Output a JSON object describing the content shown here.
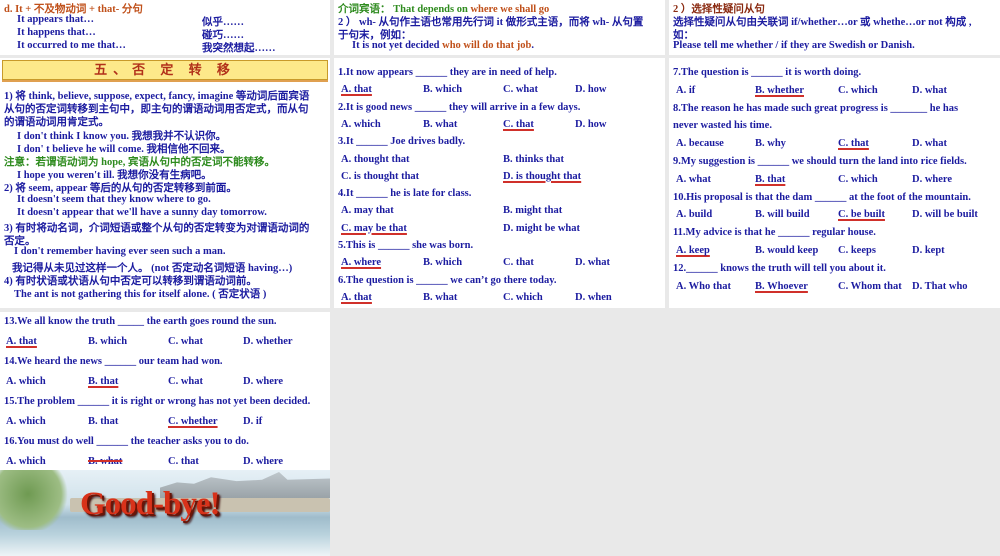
{
  "slide_tl": {
    "heading": "d. It + 不及物动词 + that- 分句",
    "rows": [
      {
        "en": "It appears that…",
        "zh": "似乎……"
      },
      {
        "en": "It happens that…",
        "zh": "碰巧……"
      },
      {
        "en": "It occurred to me that…",
        "zh": "我突然想起……"
      }
    ]
  },
  "slide_tm": {
    "clipped": "介词宾语： That depends on ",
    "clipped_hl": "where we shall go",
    "line1": "2 ） wh- 从句作主语也常用先行词 it 做形式主语，而将 wh- 从句置",
    "line2": "于句末，例如：",
    "ex_a": "It is not yet decided ",
    "ex_hl": "who will do that job",
    "ex_end": "."
  },
  "slide_tr": {
    "heading": "2 ）选择性疑问从句",
    "line1": "选择性疑问从句由关联词 if/whether…or 或 whethe…or not 构成 ,",
    "line2": "如：",
    "example": "Please tell me whether / if they are Swedish or Danish."
  },
  "slide_neg": {
    "title": "五、否 定 转 移",
    "lines": [
      {
        "t": "1)  将 think, believe, suppose, expect, fancy, imagine 等动词后面宾语",
        "c": "",
        "i": 0
      },
      {
        "t": "从句的否定词转移到主句中，即主句的谓语动词用否定式，而从句",
        "c": "",
        "i": 0
      },
      {
        "t": "的谓语动词用肯定式。",
        "c": "",
        "i": 0
      },
      {
        "t": "I don't think I know you.     我想我并不认识你。",
        "c": "",
        "i": 1
      },
      {
        "t": "I don' t believe he will come.     我相信他不回来。",
        "c": "",
        "i": 1
      },
      {
        "t": "注意：若谓语动词为 hope, 宾语从句中的否定词不能转移。",
        "c": "green",
        "i": 0
      },
      {
        "t": "I hope you weren't ill.  我想你没有生病吧。",
        "c": "",
        "i": 1
      },
      {
        "t": "2)  将 seem, appear  等后的从句的否定转移到前面。",
        "c": "",
        "i": 0
      },
      {
        "t": "It doesn't seem that they know where to go.",
        "c": "",
        "i": 1
      },
      {
        "t": "It doesn't appear that we'll have a sunny day tomorrow.",
        "c": "",
        "i": 1
      },
      {
        "t": "3)  有时将动名词，介词短语或整个从句的否定转变为对谓语动词的",
        "c": "",
        "i": 0
      },
      {
        "t": "否定。",
        "c": "",
        "i": 0
      },
      {
        "t": "I don't remember having ever seen such a man.",
        "c": "",
        "i": 2
      },
      {
        "t": "我记得从未见过这样一个人。   (not 否定动名词短语   having…)",
        "c": "",
        "i": 3
      },
      {
        "t": "4)  有时状语或状语从句中否定可以转移到谓语动词前。",
        "c": "",
        "i": 0
      },
      {
        "t": "The ant is not gathering this for itself alone.      ( 否定状语 )",
        "c": "",
        "i": 2
      }
    ]
  },
  "quiz_mid": [
    {
      "q": "1.It now appears ______ they are in need of help.",
      "cols": 4,
      "opts": [
        "A. that",
        "B. which",
        "C. what",
        "D. how"
      ],
      "ans": 0
    },
    {
      "q": "2.It is good news ______ they will arrive in a few days.",
      "cols": 4,
      "opts": [
        "A. which",
        "B. what",
        "C. that",
        "D. how"
      ],
      "ans": 2
    },
    {
      "q": "3.It ______ Joe drives badly.",
      "cols": 2,
      "opts": [
        "A. thought that",
        "B. thinks that",
        "C. is thought that",
        "D. is thought that"
      ],
      "ans": 3
    },
    {
      "q": "4.It ______ he is late for class.",
      "cols": 2,
      "opts": [
        "A. may that",
        "B. might that",
        "C. may be that",
        "D. might be what"
      ],
      "ans": 2
    },
    {
      "q": "5.This is ______ she was born.",
      "cols": 4,
      "opts": [
        "A. where",
        "B. which",
        "C. that",
        "D. what"
      ],
      "ans": 0
    },
    {
      "q": "6.The question is ______ we can’t go there today.",
      "cols": 4,
      "opts": [
        "A. that",
        "B. what",
        "C. which",
        "D. when"
      ],
      "ans": 0
    }
  ],
  "quiz_right": [
    {
      "q": "7.The question is ______ it is worth doing.",
      "cols": 4,
      "opts": [
        "A. if",
        "B. whether",
        "C. which",
        "D. what"
      ],
      "ans": 1
    },
    {
      "q": "8.The reason he has made such great progress is _______ he has",
      "q2": "never wasted his time.",
      "cols": 4,
      "opts": [
        "A. because",
        "B. why",
        "C. that",
        "D. what"
      ],
      "ans": 2
    },
    {
      "q": "9.My suggestion is ______ we should turn the land into rice fields.",
      "cols": 4,
      "opts": [
        "A. what",
        "B. that",
        "C. which",
        "D. where"
      ],
      "ans": 1
    },
    {
      "q": "10.His proposal is that the dam ______ at the foot of the mountain.",
      "cols": 4,
      "opts": [
        "A. build",
        "B. will build",
        "C. be built",
        "D. will be built"
      ],
      "ans": 2
    },
    {
      "q": "11.My advice is that he ______ regular house.",
      "cols": 4,
      "opts": [
        "A. keep",
        "B. would keep",
        "C. keeps",
        "D. kept"
      ],
      "ans": 0
    },
    {
      "q": "12.______ knows the truth will tell you about it.",
      "cols": 4,
      "opts": [
        "A. Who that",
        "B. Whoever",
        "C. Whom that",
        "D. That who"
      ],
      "ans": 1
    }
  ],
  "quiz_bottom": [
    {
      "q": "13.We all know the truth _____ the earth goes round the sun.",
      "cols": 4,
      "opts": [
        "A. that",
        "B. which",
        "C. what",
        "D. whether"
      ],
      "ans": 0
    },
    {
      "q": "14.We heard the news ______ our team had won.",
      "cols": 4,
      "opts": [
        "A. which",
        "B. that",
        "C. what",
        "D. where"
      ],
      "ans": 1
    },
    {
      "q": "15.The problem ______ it is right or wrong has not yet been decided.",
      "cols": 4,
      "opts": [
        "A. which",
        "B. that",
        "C. whether",
        "D. if"
      ],
      "ans": 2
    },
    {
      "q": "16.You must do well ______ the teacher asks you to do.",
      "cols": 4,
      "opts": [
        "A. which",
        "B. what",
        "C. that",
        "D. where"
      ],
      "ans": 1,
      "strike": true
    }
  ],
  "farewell": "Good-bye!",
  "colors": {
    "text": "#1c1ca0",
    "accent": "#c0501a",
    "answer_mark": "#d0302a",
    "note": "#2e8b1e"
  }
}
